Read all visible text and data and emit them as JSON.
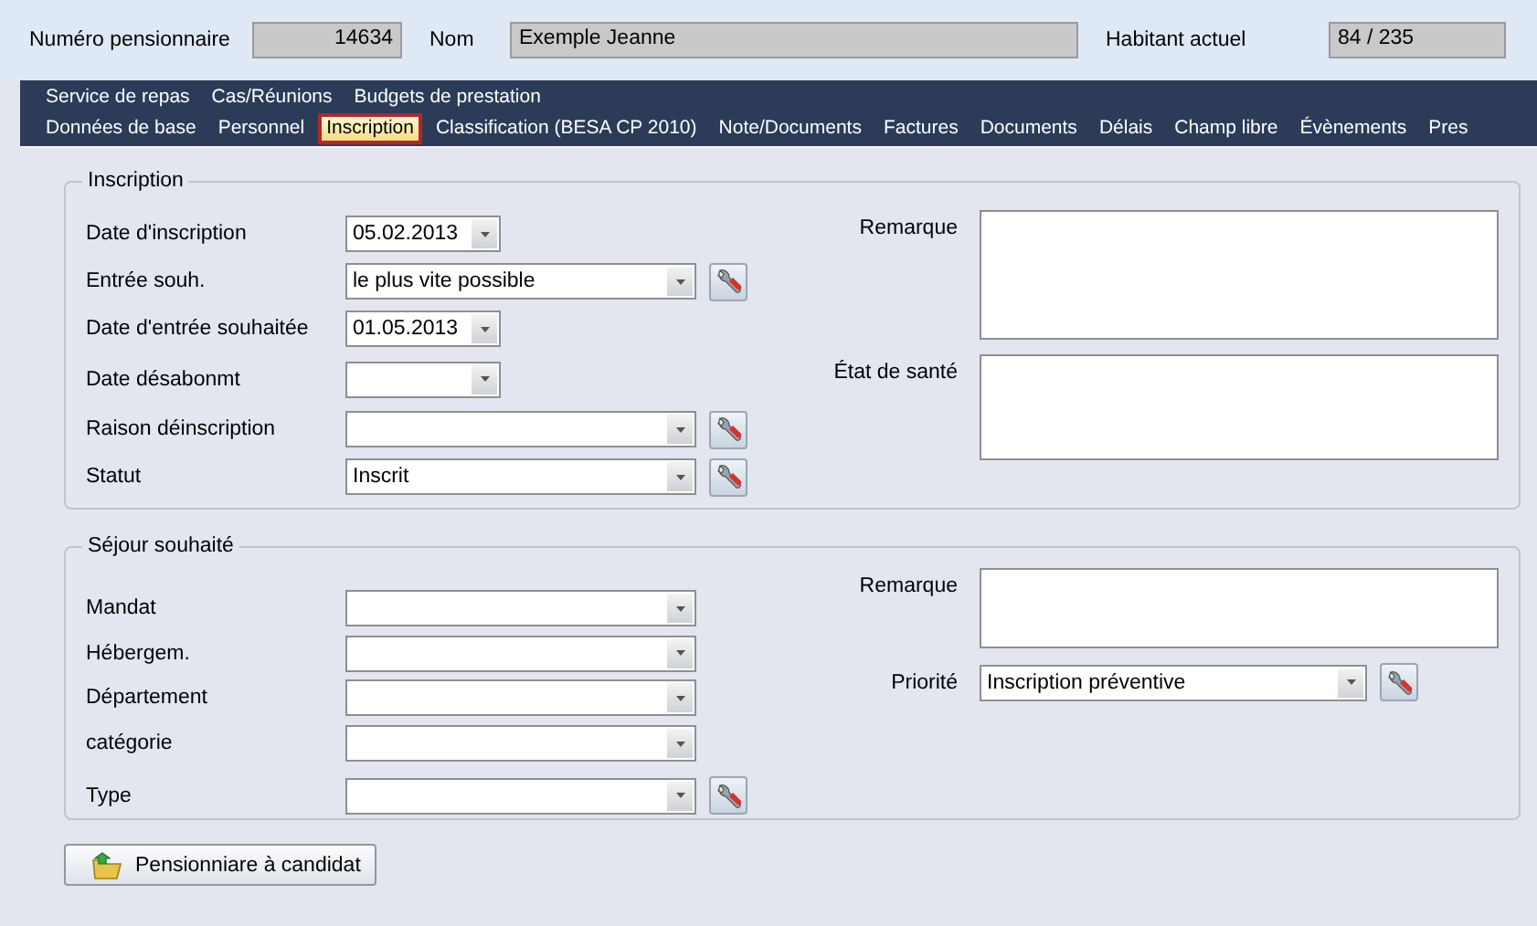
{
  "header": {
    "fields": [
      {
        "label": "Numéro pensionnaire",
        "value": "14634",
        "kind": "number"
      },
      {
        "label": "Nom",
        "value": "Exemple Jeanne",
        "kind": "text"
      },
      {
        "label": "Habitant actuel",
        "value": "84 / 235",
        "kind": "text"
      }
    ]
  },
  "tab_rows": [
    {
      "tabs": [
        {
          "label": "Service de repas",
          "selected": false
        },
        {
          "label": "Cas/Réunions",
          "selected": false
        },
        {
          "label": "Budgets de prestation",
          "selected": false
        }
      ]
    },
    {
      "tabs": [
        {
          "label": "Données de base",
          "selected": false
        },
        {
          "label": "Personnel",
          "selected": false
        },
        {
          "label": "Inscription",
          "selected": true
        },
        {
          "label": "Classification (BESA CP 2010)",
          "selected": false
        },
        {
          "label": "Note/Documents",
          "selected": false
        },
        {
          "label": "Factures",
          "selected": false
        },
        {
          "label": "Documents",
          "selected": false
        },
        {
          "label": "Délais",
          "selected": false
        },
        {
          "label": "Champ libre",
          "selected": false
        },
        {
          "label": "Évènements",
          "selected": false
        },
        {
          "label": "Pres",
          "selected": false
        }
      ]
    }
  ],
  "groups": [
    {
      "title": "Inscription",
      "left_fields": [
        {
          "label": "Date d'inscription",
          "kind": "date",
          "value": "05.02.2013",
          "lookup_button": false
        },
        {
          "label": "Entrée souh.",
          "kind": "combo",
          "value": "le plus vite possible",
          "lookup_button": true
        },
        {
          "label": "Date d'entrée souhaitée",
          "kind": "date",
          "value": "01.05.2013",
          "lookup_button": false
        },
        {
          "label": "Date désabonmt",
          "kind": "date",
          "lookup_button": false
        },
        {
          "label": "Raison déinscription",
          "kind": "combo",
          "lookup_button": true
        },
        {
          "label": "Statut",
          "kind": "combo",
          "value": "Inscrit",
          "lookup_button": true
        }
      ],
      "right_fields": [
        {
          "label": "Remarque",
          "kind": "memo",
          "lookup_button": false
        },
        {
          "label": "État de santé",
          "kind": "memo",
          "lookup_button": false
        }
      ]
    },
    {
      "title": "Séjour souhaité",
      "left_fields": [
        {
          "label": "Mandat",
          "kind": "combo",
          "lookup_button": false
        },
        {
          "label": "Hébergem.",
          "kind": "combo",
          "lookup_button": false
        },
        {
          "label": "Département",
          "kind": "combo",
          "lookup_button": false
        },
        {
          "label": "catégorie",
          "kind": "combo",
          "lookup_button": false
        },
        {
          "label": "Type",
          "kind": "combo",
          "lookup_button": true
        }
      ],
      "right_fields": [
        {
          "label": "Remarque",
          "kind": "memo",
          "lookup_button": false
        },
        {
          "label": "Priorité",
          "kind": "combo",
          "value": "Inscription préventive",
          "lookup_button": true
        }
      ]
    }
  ],
  "action_button": {
    "label": "Pensionniare à candidat"
  }
}
